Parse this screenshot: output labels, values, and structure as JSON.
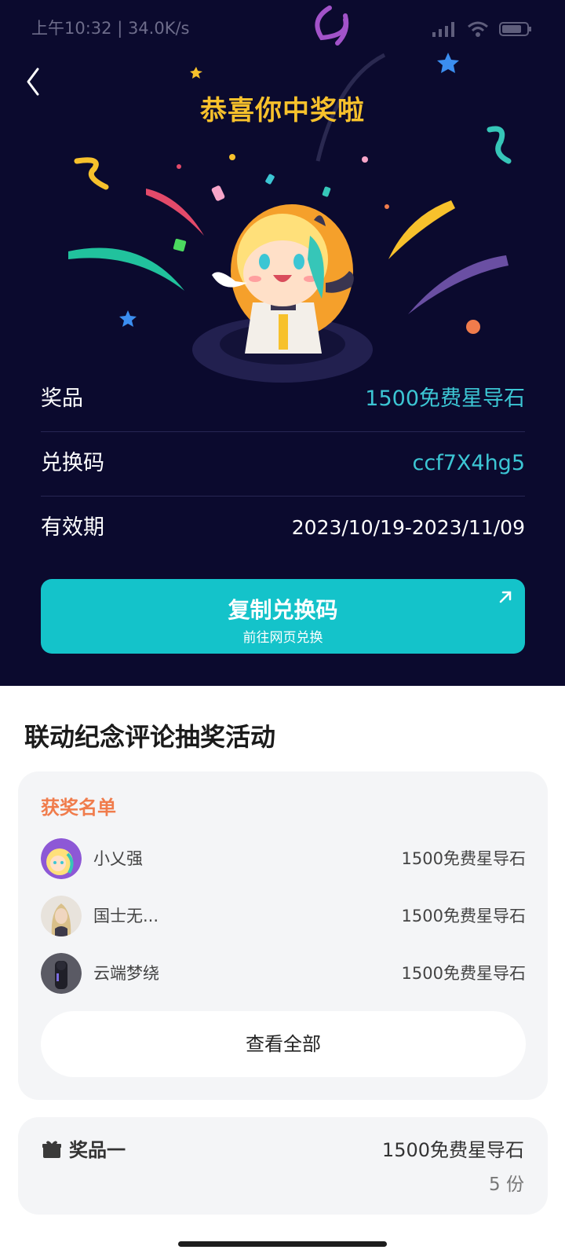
{
  "status_bar": {
    "time_text": "上午10:32 | 34.0K/s",
    "system_icons": [
      "signal-icon",
      "wifi-icon",
      "battery-icon"
    ]
  },
  "hero": {
    "title": "恭喜你中奖啦",
    "background_color": "#0b0a2e",
    "title_color": "#f7c12c"
  },
  "info": [
    {
      "label": "奖品",
      "value": "1500免费星导石"
    },
    {
      "label": "兑换码",
      "value": "ccf7X4hg5"
    },
    {
      "label": "有效期",
      "value": "2023/10/19-2023/11/09"
    }
  ],
  "copy_button": {
    "label": "复制兑换码",
    "sublabel": "前往网页兑换",
    "color": "#14c3ca"
  },
  "activity": {
    "title": "联动纪念评论抽奖活动",
    "winners_title": "获奖名单",
    "winners": [
      {
        "name": "小乂强",
        "prize": "1500免费星导石"
      },
      {
        "name": "国士无...",
        "prize": "1500免费星导石"
      },
      {
        "name": "云端梦绕",
        "prize": "1500免费星导石"
      }
    ],
    "view_all": "查看全部"
  },
  "reward": {
    "label": "奖品一",
    "value": "1500免费星导石",
    "count": "5 份"
  }
}
